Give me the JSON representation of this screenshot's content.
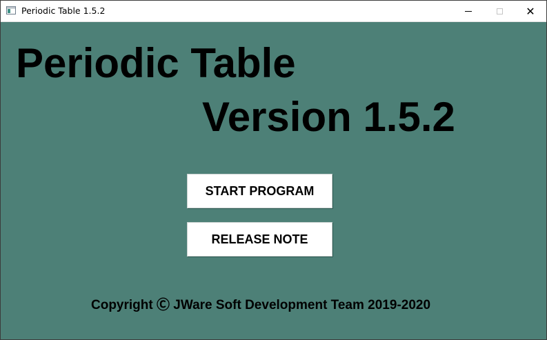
{
  "window": {
    "title": "Periodic Table 1.5.2",
    "icon": "app-window-icon",
    "controls": {
      "minimize": "minimize-icon",
      "maximize": "maximize-icon",
      "close": "✕"
    }
  },
  "colors": {
    "background": "#4d8077",
    "titlebar": "#ffffff",
    "text": "#000000",
    "button": "#ffffff"
  },
  "main": {
    "heading_line1": "Periodic Table",
    "heading_line2": "Version 1.5.2",
    "start_button": "START PROGRAM",
    "release_button": "RELEASE NOTE",
    "copyright": "Copyright Ⓒ JWare Soft Development Team 2019-2020"
  }
}
